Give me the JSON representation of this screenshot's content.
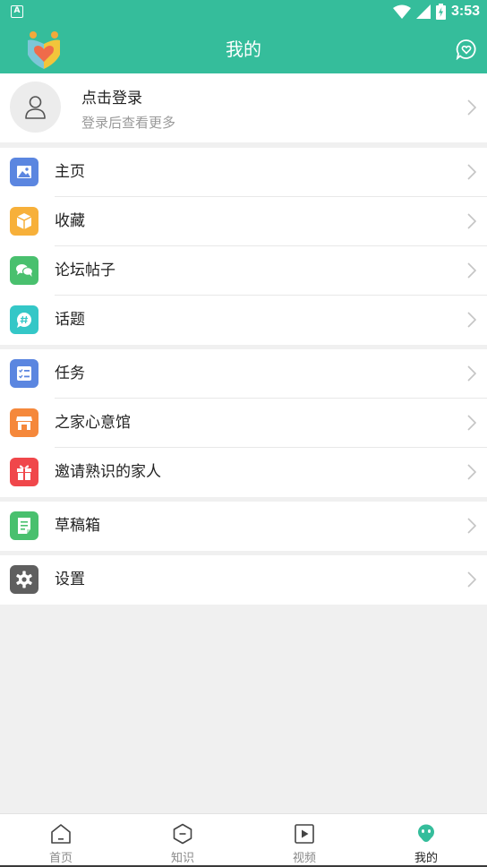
{
  "statusbar": {
    "time": "3:53",
    "notification_icon": "a-icon"
  },
  "header": {
    "title": "我的",
    "colors": {
      "bar": "#35bd9b"
    }
  },
  "profile": {
    "login": "点击登录",
    "hint": "登录后查看更多"
  },
  "groups": [
    {
      "items": [
        {
          "label": "主页",
          "icon": "image-icon",
          "color": "#5b86e0"
        },
        {
          "label": "收藏",
          "icon": "box-icon",
          "color": "#f7b03a"
        },
        {
          "label": "论坛帖子",
          "icon": "chat-bubbles-icon",
          "color": "#49c06e"
        },
        {
          "label": "话题",
          "icon": "hashtag-icon",
          "color": "#34c7c7"
        }
      ]
    },
    {
      "items": [
        {
          "label": "任务",
          "icon": "task-list-icon",
          "color": "#5b86e0"
        },
        {
          "label": "之家心意馆",
          "icon": "store-icon",
          "color": "#f5883b"
        },
        {
          "label": "邀请熟识的家人",
          "icon": "gift-icon",
          "color": "#f0474b"
        }
      ]
    },
    {
      "items": [
        {
          "label": "草稿箱",
          "icon": "draft-icon",
          "color": "#49c06e"
        }
      ]
    },
    {
      "items": [
        {
          "label": "设置",
          "icon": "gear-icon",
          "color": "#5f5f5f"
        }
      ]
    }
  ],
  "tabs": [
    {
      "label": "首页",
      "icon": "home-icon",
      "active": false
    },
    {
      "label": "知识",
      "icon": "knowledge-icon",
      "active": false
    },
    {
      "label": "视频",
      "icon": "video-icon",
      "active": false
    },
    {
      "label": "我的",
      "icon": "mine-icon",
      "active": true
    }
  ]
}
